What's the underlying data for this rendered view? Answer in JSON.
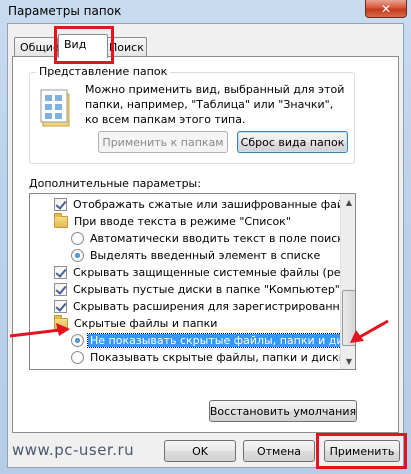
{
  "window": {
    "title": "Параметры папок",
    "close_glyph": "✕"
  },
  "tabs": [
    {
      "label": "Общие"
    },
    {
      "label": "Вид"
    },
    {
      "label": "Поиск"
    }
  ],
  "folder_view": {
    "legend": "Представление папок",
    "description": "Можно применить вид, выбранный для этой папки, например, \"Таблица\" или \"Значки\", ко всем папкам этого типа.",
    "apply_button": "Применить к папкам",
    "reset_button": "Сброс вида папок"
  },
  "advanced": {
    "label": "Дополнительные параметры:",
    "items": [
      {
        "kind": "checkbox",
        "checked": true,
        "label": "Отображать сжатые или зашифрованные файлы NTFS"
      },
      {
        "kind": "folder",
        "label": "При вводе текста в режиме \"Список\""
      },
      {
        "kind": "radio",
        "checked": false,
        "label": "Автоматически вводить текст в поле поиска"
      },
      {
        "kind": "radio",
        "checked": true,
        "label": "Выделять введенный элемент в списке"
      },
      {
        "kind": "checkbox",
        "checked": true,
        "label": "Скрывать защищенные системные файлы (рекомендуется)"
      },
      {
        "kind": "checkbox",
        "checked": true,
        "label": "Скрывать пустые диски в папке \"Компьютер\""
      },
      {
        "kind": "checkbox",
        "checked": true,
        "label": "Скрывать расширения для зарегистрированных типов файлов"
      },
      {
        "kind": "folder",
        "label": "Скрытые файлы и папки"
      },
      {
        "kind": "radio",
        "checked": true,
        "selected": true,
        "label": "Не показывать скрытые файлы, папки и диски"
      },
      {
        "kind": "radio",
        "checked": false,
        "label": "Показывать скрытые файлы, папки и диски"
      }
    ],
    "restore_button": "Восстановить умолчания"
  },
  "footer": {
    "watermark": "www.pc-user.ru",
    "ok": "OK",
    "cancel": "Отмена",
    "apply": "Применить"
  },
  "colors": {
    "highlight": "#e3141f",
    "selection": "#3399ff"
  },
  "icons": {
    "folder_options": "folder-options-icon",
    "group_item": "folder-icon"
  }
}
